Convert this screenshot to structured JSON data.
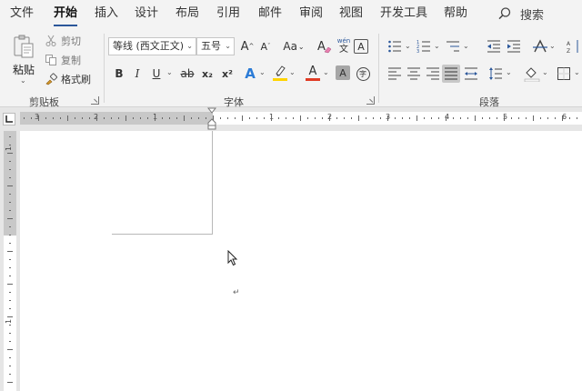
{
  "menu": {
    "tabs": [
      "文件",
      "开始",
      "插入",
      "设计",
      "布局",
      "引用",
      "邮件",
      "审阅",
      "视图",
      "开发工具",
      "帮助"
    ],
    "active_tab": "开始",
    "search_label": "搜索"
  },
  "clipboard": {
    "paste_label": "粘贴",
    "cut_label": "剪切",
    "copy_label": "复制",
    "format_painter_label": "格式刷",
    "group_label": "剪贴板"
  },
  "font": {
    "font_name": "等线 (西文正文)",
    "font_size": "五号",
    "grow_label": "A",
    "shrink_label": "A",
    "case_label": "Aa",
    "phonetic_top": "wén",
    "phonetic_bottom": "文",
    "border_char_label": "A",
    "bold_label": "B",
    "italic_label": "I",
    "underline_label": "U",
    "strike_label": "ab",
    "subscript_label": "x₂",
    "superscript_label": "x²",
    "effects_label": "A",
    "font_color_label": "A",
    "shading_label": "A",
    "enclose_label": "字",
    "group_label": "字体",
    "font_color": "#e03b24",
    "highlight_color": "#ffd400"
  },
  "paragraph": {
    "group_label": "段落"
  },
  "ruler": {
    "h_numbers": [
      "3",
      "2",
      "1",
      "1",
      "2",
      "3",
      "4",
      "5",
      "6"
    ],
    "v_numbers": [
      "1",
      "1"
    ]
  },
  "document": {
    "paragraph_mark": "↵"
  },
  "colors": {
    "accent": "#2b579a",
    "ribbon_bg": "#f3f3f3"
  }
}
